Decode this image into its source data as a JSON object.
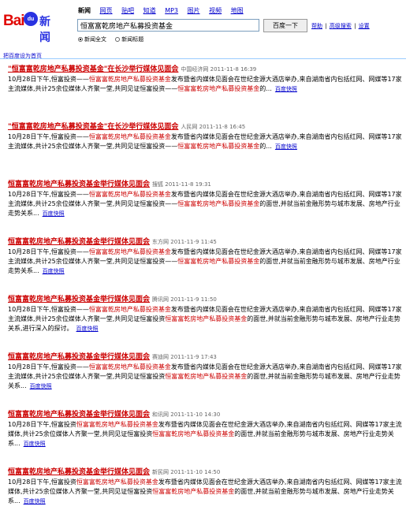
{
  "logo": {
    "bai": "Bai",
    "du": "du",
    "news": "新闻"
  },
  "nav": {
    "items": [
      "新闻",
      "网页",
      "贴吧",
      "知道",
      "MP3",
      "图片",
      "视频",
      "地图"
    ]
  },
  "search": {
    "query": "恒富富乾房地产私募投资基金",
    "button": "百度一下"
  },
  "links": {
    "help": "帮助",
    "advanced": "高级搜索",
    "settings": "设置"
  },
  "radios": {
    "full": "新闻全文",
    "title": "新闻标题"
  },
  "sethome": "把百度设为首页",
  "results": [
    {
      "title": "\"恒富富乾房地产私募投资基金\"在长沙举行媒体见面会",
      "source": "中国经济网 2011-11-8 16:39",
      "s1": "10月28日下午,恒富投资——",
      "h1": "恒富富乾房地产私募投资基金",
      "s2": "发布暨省内媒体见面会在世纪金源大酒店举办,来自湖南省内包括红网、网媒等17家主流媒体,共计25余位媒体人齐聚一堂,共同见证恒富投资——",
      "h2": "恒富富乾房地产私募投资基金",
      "s3": "的...",
      "cache": "百度快照"
    },
    {
      "title": "\"恒富富乾房地产私募投资基金\"在长沙举行媒体见面会",
      "source": "人民网 2011-11-8 16:45",
      "s1": "10月28日下午,恒富投资——",
      "h1": "恒富富乾房地产私募投资基金",
      "s2": "发布暨省内媒体见面会在世纪金源大酒店举办,来自湖南省内包括红网、网媒等17家主流媒体,共计25余位媒体人齐聚一堂,共同见证恒富投资——",
      "h2": "恒富富乾房地产私募投资基金",
      "s3": "的...",
      "cache": "百度快照"
    },
    {
      "title": "恒富富乾房地产私募投资基金举行媒体见面会",
      "source": "搜狐 2011-11-8 19:31",
      "s1": "10月28日下午,恒富投资——",
      "h1": "恒富富乾房地产私募投资基金",
      "s2": "发布暨省内媒体见面会在世纪金源大酒店举办,来自湖南省内包括红网、网媒等17家主流媒体,共计25余位媒体人齐聚一堂,共同见证恒富投资——",
      "h2": "恒富富乾房地产私募投资基金",
      "s3": "的面世,并就当前金融形势与城市发展、房地产行业走势关系...",
      "cache": "百度快照"
    },
    {
      "title": "恒富富乾房地产私募投资基金举行媒体见面会",
      "source": "东方网 2011-11-9 11:45",
      "s1": "10月28日下午,恒富投资——",
      "h1": "恒富富乾房地产私募投资基金",
      "s2": "发布暨省内媒体见面会在世纪金源大酒店举办,来自湖南省内包括红网、网媒等17家主流媒体,共计25余位媒体人齐聚一堂,共同见证恒富投资——",
      "h2": "恒富富乾房地产私募投资基金",
      "s3": "的面世,并就当前金融形势与城市发展、房地产行业走势关系...",
      "cache": "百度快照"
    },
    {
      "title": "恒富富乾房地产私募投资基金举行媒体见面会",
      "source": "腾讯网 2011-11-9 11:50",
      "s1": "10月28日下午,恒富投资——",
      "h1": "恒富富乾房地产私募投资基金",
      "s2": "发布暨省内媒体见面会在世纪金源大酒店举办,来自湖南省内包括红网、网媒等17家主流媒体,共计25余位媒体人齐聚一堂,共同见证恒富投资",
      "h2": "恒富富乾房地产私募投资基金",
      "s3": "的面世,并就当前金融形势与城市发展、房地产行业走势关系,进行深入的探讨。",
      "cache": "百度快照"
    },
    {
      "title": "恒富富乾房地产私募投资基金举行媒体见面会",
      "source": "赛迪网 2011-11-9 17:43",
      "s1": "10月28日下午,恒富投资——",
      "h1": "恒富富乾房地产私募投资基金",
      "s2": "发布暨省内媒体见面会在世纪金源大酒店举办,来自湖南省内包括红网、网媒等17家主流媒体,共计25余位媒体人齐聚一堂,共同见证恒富投资",
      "h2": "恒富富乾房地产私募投资基金",
      "s3": "的面世,并就当前金融形势与城市发展、房地产行业走势关系...",
      "cache": "百度快照"
    },
    {
      "title": "恒富富乾房地产私募投资基金举行媒体见面会",
      "source": "和讯网 2011-11-10 14:30",
      "s1": "10月28日下午,恒富投资",
      "h1": "恒富富乾房地产私募投资基金",
      "s2": "发布暨省内媒体见面会在世纪金源大酒店举办,来自湖南省内包括红网、网媒等17家主流媒体,共计25余位媒体人齐聚一堂,共同见证恒富投资",
      "h2": "恒富富乾房地产私募投资基金",
      "s3": "的面世,并就当前金融形势与城市发展、房地产行业走势关系...",
      "cache": "百度快照"
    },
    {
      "title": "恒富富乾房地产私募投资基金举行媒体见面会",
      "source": "新民网 2011-11-10 14:50",
      "s1": "10月28日下午,恒富投资",
      "h1": "恒富富乾房地产私募投资基金",
      "s2": "发布暨省内媒体见面会在世纪金源大酒店举办,来自湖南省内包括红网、网媒等17家主流媒体,共计25余位媒体人齐聚一堂,共同见证恒富投资",
      "h2": "恒富富乾房地产私募投资基金",
      "s3": "的面世,并就当前金融形势与城市发展、房地产行业走势关系...",
      "cache": "百度快照"
    }
  ]
}
